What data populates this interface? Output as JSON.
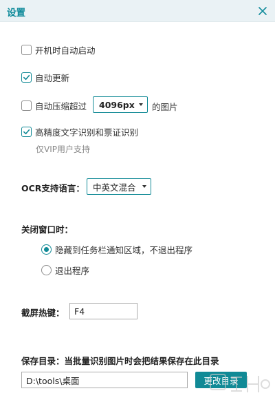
{
  "window": {
    "title": "设置"
  },
  "options": {
    "autostart": {
      "label": "开机时自动启动",
      "checked": false
    },
    "autoupdate": {
      "label": "自动更新",
      "checked": true
    },
    "compress": {
      "label": "自动压缩超过",
      "checked": false,
      "size_value": "4096px",
      "suffix": "的图片"
    },
    "high_precision": {
      "label": "高精度文字识别和票证识别",
      "checked": true,
      "note": "仅VIP用户支持"
    }
  },
  "ocr_language": {
    "label": "OCR支持语言：",
    "value": "中英文混合"
  },
  "close_window": {
    "label": "关闭窗口时：",
    "options": [
      {
        "label": "隐藏到任务栏通知区域，不退出程序",
        "checked": true
      },
      {
        "label": "退出程序",
        "checked": false
      }
    ]
  },
  "hotkey": {
    "label": "截屏热键：",
    "value": "F4"
  },
  "save_dir": {
    "label": "保存目录：当批量识别图片时会把结果保存在此目录",
    "path": "D:\\tools\\桌面",
    "button_label": "更改目录"
  },
  "colors": {
    "accent": "#118a96",
    "title": "#0e8a9a",
    "titlebar_bg": "#eaf2f5"
  }
}
